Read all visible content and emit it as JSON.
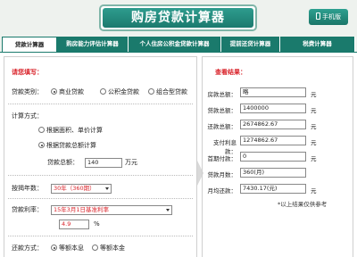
{
  "header": {
    "title": "购房贷款计算器",
    "mobile_label": "手机版"
  },
  "tabs": [
    {
      "label": "贷款计算器",
      "active": true
    },
    {
      "label": "购房能力评估计算器",
      "active": false
    },
    {
      "label": "个人住房公积金贷款计算器",
      "active": false
    },
    {
      "label": "提前还贷计算器",
      "active": false
    },
    {
      "label": "税费计算器",
      "active": false
    }
  ],
  "form": {
    "section_title": "请您填写：",
    "loan_type": {
      "label": "贷款类别：",
      "options": [
        "商业贷款",
        "公积金贷款",
        "组合型贷款"
      ],
      "selected": 0
    },
    "calc_method": {
      "label": "计算方式：",
      "options": [
        "根据面积、单价计算",
        "根据贷款总额计算"
      ],
      "selected": 1
    },
    "loan_total": {
      "label": "贷款总额：",
      "value": "140",
      "unit": "万元"
    },
    "term": {
      "label": "按揭年数：",
      "value": "30年（360期）"
    },
    "rate": {
      "label": "贷款利率：",
      "value": "15年3月1日基准利率",
      "rate_value": "4.9",
      "unit": "%"
    },
    "repay": {
      "label": "还款方式：",
      "options": [
        "等额本息",
        "等额本金"
      ],
      "selected": 0
    }
  },
  "results": {
    "section_title": "查看结果：",
    "rows": [
      {
        "label": "房款总额：",
        "value": "略",
        "unit": "元"
      },
      {
        "label": "贷款总额：",
        "value": "1400000",
        "unit": "元"
      },
      {
        "label": "还款总额：",
        "value": "2674862.67",
        "unit": "元"
      },
      {
        "label": "支付利息款：",
        "value": "1274862.67",
        "unit": "元"
      },
      {
        "label": "首期付款：",
        "value": "0",
        "unit": "元"
      },
      {
        "label": "贷款月数：",
        "value": "360(月)",
        "unit": ""
      },
      {
        "label": "月均还款：",
        "value": "7430.17(元)",
        "unit": "元"
      }
    ],
    "note": "*以上结果仅供参考"
  },
  "colors": {
    "brand": "#1a7a6c",
    "accent_red": "#d9232a"
  }
}
